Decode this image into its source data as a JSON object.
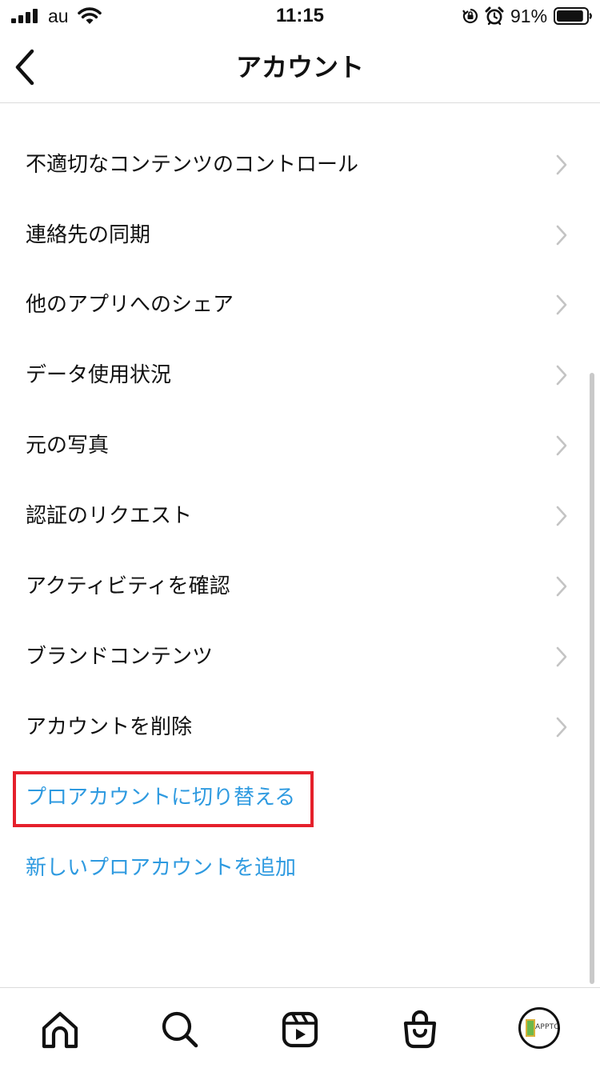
{
  "status_bar": {
    "carrier": "au",
    "time": "11:15",
    "battery_percent": "91%",
    "battery_level": 0.91,
    "icons": [
      "signal-icon",
      "wifi-icon",
      "orientation-lock-icon",
      "alarm-icon",
      "battery-icon"
    ]
  },
  "header": {
    "title": "アカウント",
    "back_icon": "chevron-left-icon"
  },
  "menu": {
    "items": [
      {
        "label": "不適切なコンテンツのコントロール"
      },
      {
        "label": "連絡先の同期"
      },
      {
        "label": "他のアプリへのシェア"
      },
      {
        "label": "データ使用状況"
      },
      {
        "label": "元の写真"
      },
      {
        "label": "認証のリクエスト"
      },
      {
        "label": "アクティビティを確認"
      },
      {
        "label": "ブランドコンテンツ"
      },
      {
        "label": "アカウントを削除"
      }
    ],
    "links": [
      {
        "label": "プロアカウントに切り替える",
        "highlighted": true
      },
      {
        "label": "新しいプロアカウントを追加",
        "highlighted": false
      }
    ],
    "link_color": "#2e9ae0",
    "highlight_color": "#e5202b"
  },
  "tab_bar": {
    "tabs": [
      "home-icon",
      "search-icon",
      "reels-icon",
      "shop-icon"
    ],
    "profile": {
      "avatar_text": "APPTO"
    }
  }
}
